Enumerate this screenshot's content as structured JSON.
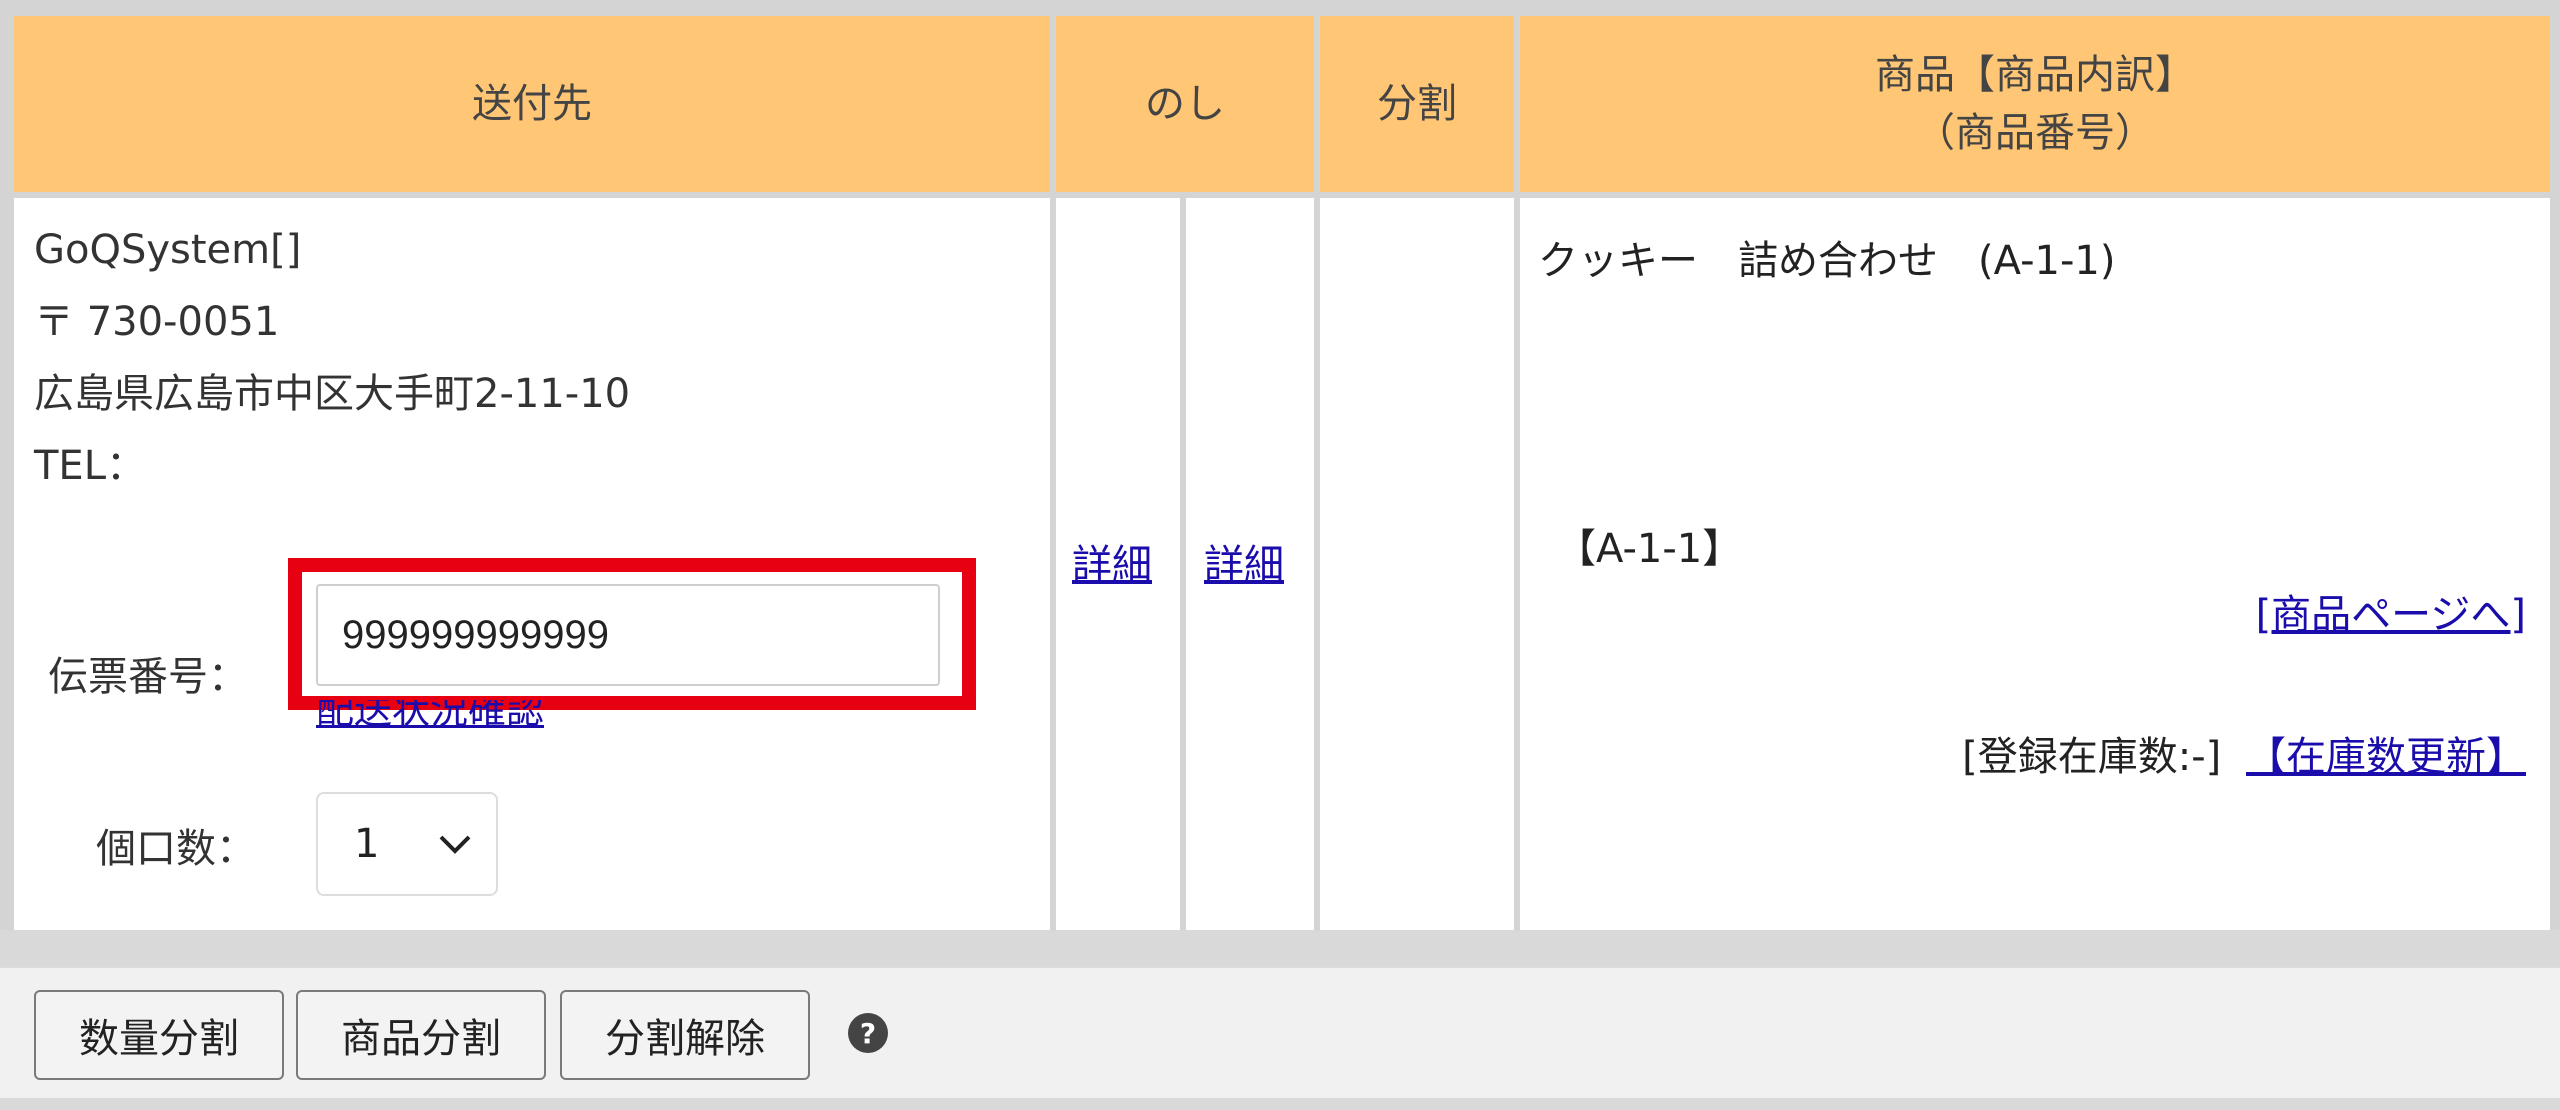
{
  "header": {
    "destination": "送付先",
    "noshi": "のし",
    "split": "分割",
    "product_line1": "商品【商品内訳】",
    "product_line2": "（商品番号）"
  },
  "address": {
    "name": "GoQSystem[]",
    "postal": "〒 730-0051",
    "address": "広島県広島市中区大手町2-11-10",
    "tel": "TEL："
  },
  "slip": {
    "label": "伝票番号：",
    "value": "999999999999",
    "tracking_link": "配送状況確認"
  },
  "quantity": {
    "label": "個口数：",
    "selected": "1"
  },
  "noshi_links": [
    "詳細",
    "詳細"
  ],
  "product": {
    "name": "クッキー　詰め合わせ　(A-1-1)",
    "code": "【A-1-1】",
    "page_link": "[商品ページへ]",
    "stock_label": "[登録在庫数:-]",
    "stock_update_link": "【在庫数更新】"
  },
  "footer": {
    "qty_split": "数量分割",
    "product_split": "商品分割",
    "cancel_split": "分割解除",
    "help_icon": "question-circle-icon"
  },
  "colors": {
    "header_bg": "#ffc675",
    "highlight": "#e60012",
    "link": "#1a0dab"
  }
}
